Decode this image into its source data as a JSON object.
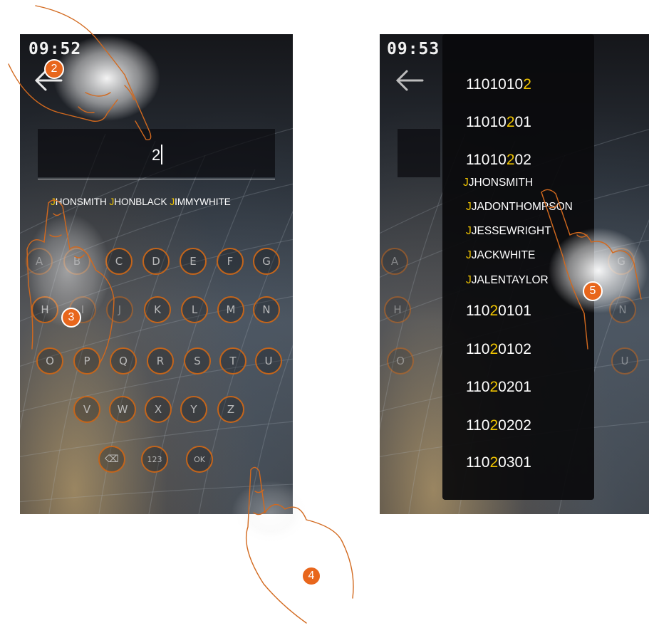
{
  "left_screen": {
    "time": "09:52",
    "search_value": "2",
    "suggestions": [
      {
        "hl": "J",
        "rest": "HONSMITH"
      },
      {
        "hl": "J",
        "rest": "HONBLACK"
      },
      {
        "hl": "J",
        "rest": "IMMYWHITE"
      }
    ],
    "keys_row1": [
      "A",
      "B",
      "C",
      "D",
      "E",
      "F",
      "G"
    ],
    "keys_row2": [
      "H",
      "I",
      "J",
      "K",
      "L",
      "M",
      "N"
    ],
    "keys_row3": [
      "O",
      "P",
      "Q",
      "R",
      "S",
      "T",
      "U"
    ],
    "keys_row4": [
      "V",
      "W",
      "X",
      "Y",
      "Z"
    ],
    "key_delete": "⌫",
    "key_numbers": "123",
    "key_ok": "OK"
  },
  "right_screen": {
    "time": "09:53",
    "bg_keys": [
      "A",
      "H",
      "O",
      "N",
      "U",
      "G"
    ],
    "list": [
      {
        "pre": "1101010",
        "hl": "2",
        "post": "",
        "size": "big"
      },
      {
        "pre": "110102",
        "hl": "",
        "post": "",
        "size": "big",
        "alt": {
          "pre": "11010",
          "hl": "2",
          "post": "01"
        }
      },
      {
        "pre": "11010",
        "hl": "2",
        "post": "02",
        "size": "big"
      },
      {
        "pre": "",
        "hl": "J",
        "post": "JHONSMITH",
        "size": "small"
      },
      {
        "pre": "",
        "hl": "J",
        "post": "JADONTHOMPSON",
        "size": "small"
      },
      {
        "pre": "",
        "hl": "J",
        "post": "JESSEWRIGHT",
        "size": "small"
      },
      {
        "pre": "",
        "hl": "J",
        "post": "JACKWHITE",
        "size": "small"
      },
      {
        "pre": "",
        "hl": "J",
        "post": "JALENTAYLOR",
        "size": "small"
      },
      {
        "pre": "110",
        "hl": "2",
        "post": "0101",
        "size": "big"
      },
      {
        "pre": "110",
        "hl": "2",
        "post": "0102",
        "size": "big"
      },
      {
        "pre": "110",
        "hl": "2",
        "post": "0201",
        "size": "big"
      },
      {
        "pre": "110",
        "hl": "2",
        "post": "0202",
        "size": "big"
      },
      {
        "pre": "110",
        "hl": "2",
        "post": "0301",
        "size": "big"
      }
    ]
  },
  "steps": {
    "s2": "2",
    "s3": "3",
    "s4": "4",
    "s5": "5"
  },
  "colors": {
    "accent": "#e8661c",
    "highlight": "#f0c400",
    "key_ring": "#c4651b"
  },
  "icons": [
    "back-arrow-icon",
    "delete-icon",
    "pointing-hand-icon"
  ]
}
